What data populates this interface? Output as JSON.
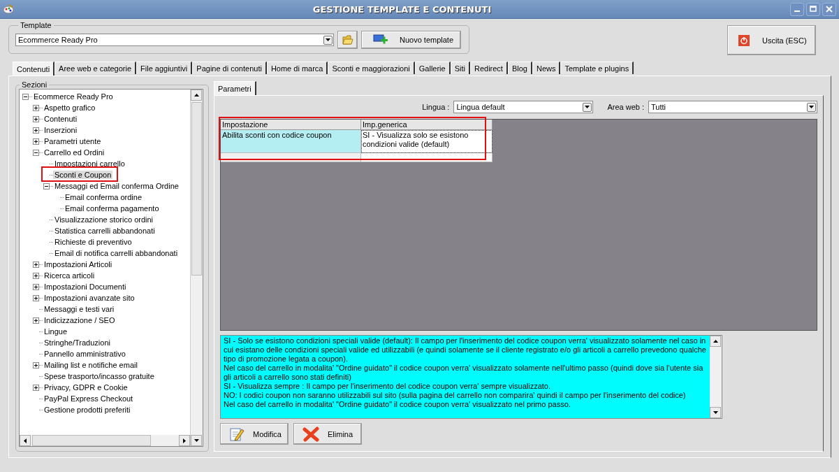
{
  "window": {
    "title": "GESTIONE TEMPLATE E CONTENUTI"
  },
  "template": {
    "label": "Template",
    "value": "Ecommerce Ready Pro",
    "new_button": "Nuovo template"
  },
  "exit_button": "Uscita (ESC)",
  "tabs": [
    {
      "label": "Contenuti",
      "selected": true
    },
    {
      "label": "Aree web e categorie",
      "selected": false
    },
    {
      "label": "File aggiuntivi",
      "selected": false
    },
    {
      "label": "Pagine di contenuti",
      "selected": false
    },
    {
      "label": "Home di marca",
      "selected": false
    },
    {
      "label": "Sconti e maggiorazioni",
      "selected": false
    },
    {
      "label": "Gallerie",
      "selected": false
    },
    {
      "label": "Siti",
      "selected": false
    },
    {
      "label": "Redirect",
      "selected": false
    },
    {
      "label": "Blog",
      "selected": false
    },
    {
      "label": "News",
      "selected": false
    },
    {
      "label": "Template e plugins",
      "selected": false
    }
  ],
  "sections": {
    "label": "Sezioni",
    "tree": [
      {
        "label": "Ecommerce Ready Pro",
        "kind": "node",
        "expanded": true,
        "selected": false,
        "children": [
          {
            "label": "Aspetto grafico",
            "kind": "node",
            "expanded": false,
            "selected": false
          },
          {
            "label": "Contenuti",
            "kind": "node",
            "expanded": false,
            "selected": false
          },
          {
            "label": "Inserzioni",
            "kind": "node",
            "expanded": false,
            "selected": false
          },
          {
            "label": "Parametri utente",
            "kind": "node",
            "expanded": false,
            "selected": false
          },
          {
            "label": "Carrello ed Ordini",
            "kind": "node",
            "expanded": true,
            "selected": false,
            "children": [
              {
                "label": "Impostazioni carrello",
                "kind": "leaf",
                "selected": false
              },
              {
                "label": "Sconti e Coupon",
                "kind": "leaf",
                "selected": true,
                "highlighted": true
              },
              {
                "label": "Messaggi ed Email conferma Ordine",
                "kind": "node",
                "expanded": true,
                "selected": false,
                "children": [
                  {
                    "label": "Email conferma ordine",
                    "kind": "leaf",
                    "selected": false
                  },
                  {
                    "label": "Email conferma pagamento",
                    "kind": "leaf",
                    "selected": false
                  }
                ]
              },
              {
                "label": "Visualizzazione storico ordini",
                "kind": "leaf",
                "selected": false
              },
              {
                "label": "Statistica carrelli abbandonati",
                "kind": "leaf",
                "selected": false
              },
              {
                "label": "Richieste di preventivo",
                "kind": "leaf",
                "selected": false
              },
              {
                "label": "Email di notifica carrelli abbandonati",
                "kind": "leaf",
                "selected": false
              }
            ]
          },
          {
            "label": "Impostazioni Articoli",
            "kind": "node",
            "expanded": false,
            "selected": false
          },
          {
            "label": "Ricerca articoli",
            "kind": "node",
            "expanded": false,
            "selected": false
          },
          {
            "label": "Impostazioni Documenti",
            "kind": "node",
            "expanded": false,
            "selected": false
          },
          {
            "label": "Impostazioni avanzate sito",
            "kind": "node",
            "expanded": false,
            "selected": false
          },
          {
            "label": "Messaggi e testi vari",
            "kind": "leaf",
            "selected": false
          },
          {
            "label": "Indicizzazione / SEO",
            "kind": "node",
            "expanded": false,
            "selected": false
          },
          {
            "label": "Lingue",
            "kind": "leaf",
            "selected": false
          },
          {
            "label": "Stringhe/Traduzioni",
            "kind": "leaf",
            "selected": false
          },
          {
            "label": "Pannello amministrativo",
            "kind": "leaf",
            "selected": false
          },
          {
            "label": "Mailing list e notifiche email",
            "kind": "node",
            "expanded": false,
            "selected": false
          },
          {
            "label": "Spese trasporto/incasso gratuite",
            "kind": "leaf",
            "selected": false
          },
          {
            "label": "Privacy, GDPR e Cookie",
            "kind": "node",
            "expanded": false,
            "selected": false
          },
          {
            "label": "PayPal Express Checkout",
            "kind": "leaf",
            "selected": false
          },
          {
            "label": "Gestione prodotti preferiti",
            "kind": "leaf",
            "selected": false
          }
        ]
      }
    ]
  },
  "subtabs": [
    {
      "label": "Parametri",
      "selected": true
    }
  ],
  "filters": [
    {
      "label": "Lingua :",
      "value": "Lingua default"
    },
    {
      "label": "Area web :",
      "value": "Tutti"
    }
  ],
  "table": {
    "highlighted": true,
    "columns": [
      "Impostazione",
      "Imp.generica"
    ],
    "rows": [
      {
        "cells": [
          "Abilita sconti con codice coupon",
          "SI - Visualizza solo se esistono condizioni valide (default)"
        ],
        "selected": true
      }
    ]
  },
  "description": [
    "SI - Solo se esistono condizioni speciali valide (default): Il campo per l'inserimento del codice coupon verra' visualizzato solamente nel caso in cui esistano delle condizioni speciali valide ed utilizzabili (e quindi solamente se il cliente registrato e/o gli articoli a carrello prevedono qualche tipo di promozione legata a coupon).",
    "Nel caso del carrello in modalita' \"Ordine guidato\" il codice coupon verra' visualizzato solamente nell'ultimo passo (quindi dove sia l'utente sia gli articoli a carrello sono stati definiti)",
    "SI - Visualizza sempre : Il campo per l'inserimento del codice coupon verra' sempre visualizzato.",
    "NO: I codici coupon non saranno utilizzabili sul sito (sulla pagina del carrello non comparira' quindi il campo per l'inserimento del codice)",
    "Nel caso del carrello in modalita' \"Ordine guidato\" il codice coupon verra' visualizzato nel primo passo."
  ],
  "buttons": [
    {
      "label": "Modifica",
      "kind": "edit"
    },
    {
      "label": "Elimina",
      "kind": "delete"
    }
  ]
}
